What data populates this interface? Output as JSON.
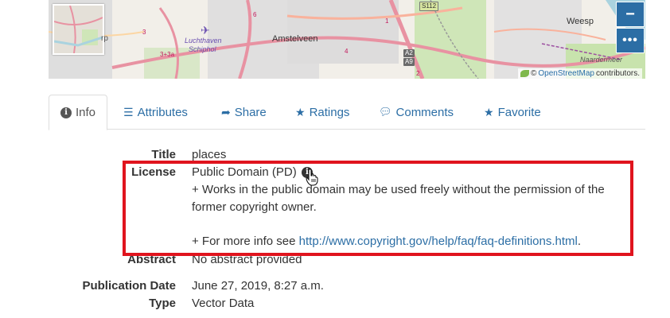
{
  "map": {
    "labels": {
      "amstelveen": "Amstelveen",
      "weesp": "Weesp",
      "schiphol_line1": "Luchthaven",
      "schiphol_line2": "Schiphol",
      "naardermeer": "Naardermeer",
      "rp": "rp"
    },
    "road_numbers": [
      "6",
      "4",
      "3",
      "3+3a",
      "2",
      "1",
      "A2",
      "A9",
      "S112"
    ],
    "attribution": {
      "copyright": "©",
      "link": "OpenStreetMap",
      "suffix": "contributors."
    },
    "controls": {
      "zoom_out": "−",
      "more": "•••"
    }
  },
  "tabs": [
    {
      "label": "Info",
      "icon": "info-circle-icon",
      "active": true
    },
    {
      "label": "Attributes",
      "icon": "list-icon"
    },
    {
      "label": "Share",
      "icon": "share-icon"
    },
    {
      "label": "Ratings",
      "icon": "star-icon"
    },
    {
      "label": "Comments",
      "icon": "comment-icon"
    },
    {
      "label": "Favorite",
      "icon": "star-icon"
    }
  ],
  "details": {
    "title": {
      "label": "Title",
      "value": "places"
    },
    "license": {
      "label": "License",
      "value": "Public Domain (PD)",
      "line1": "+ Works in the public domain may be used freely without the permission of the",
      "line2": "former copyright owner.",
      "more_prefix": "+ For more info see ",
      "more_link": "http://www.copyright.gov/help/faq/faq-definitions.html",
      "more_suffix": "."
    },
    "abstract": {
      "label": "Abstract",
      "value": "No abstract provided"
    },
    "publication_date": {
      "label": "Publication Date",
      "value": "June 27, 2019, 8:27 a.m."
    },
    "type": {
      "label": "Type",
      "value": "Vector Data"
    }
  },
  "colors": {
    "link": "#2c6ea5",
    "highlight": "#e0141e",
    "map_control": "#2c6ea5"
  }
}
